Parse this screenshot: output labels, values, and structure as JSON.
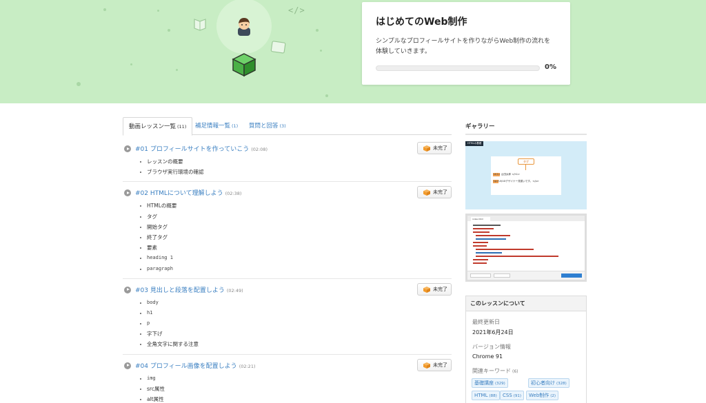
{
  "hero": {
    "code_icon": "</>",
    "title": "はじめてのWeb制作",
    "description": "シンプルなプロフィールサイトを作りながらWeb制作の流れを体験していきます。",
    "progress_percent": 0,
    "progress_label": "0%",
    "colors": {
      "background": "#c8edc4",
      "accent": "#7cc576"
    }
  },
  "tabs": [
    {
      "label": "動画レッスン一覧",
      "count": "(11)",
      "active": true
    },
    {
      "label": "補足情報一覧",
      "count": "(1)",
      "active": false
    },
    {
      "label": "質問と回答",
      "count": "(3)",
      "active": false
    }
  ],
  "lessons": [
    {
      "title": "#01 プロフィールサイトを作っていこう",
      "duration": "(02:08)",
      "status": "未完了",
      "topics": [
        "レッスンの概要",
        "ブラウザ実行環境の確認"
      ]
    },
    {
      "title": "#02 HTMLについて理解しよう",
      "duration": "(02:38)",
      "status": "未完了",
      "topics": [
        "HTMLの概要",
        "タグ",
        "開始タグ",
        "終了タグ",
        "要素",
        "heading 1",
        "paragraph"
      ]
    },
    {
      "title": "#03 見出しと段落を配置しよう",
      "duration": "(02:49)",
      "status": "未完了",
      "topics": [
        "body",
        "h1",
        "p",
        "字下げ",
        "全角文字に関する注意"
      ]
    },
    {
      "title": "#04 プロフィール画像を配置しよう",
      "duration": "(02:21)",
      "status": "未完了",
      "topics": [
        "img",
        "src属性",
        "alt属性"
      ]
    }
  ],
  "sidebar": {
    "gallery_title": "ギャラリー",
    "gallery1": {
      "tag": "HTMLの基礎",
      "box": "タグ",
      "line1": "<h1> 山田太郎 </h1>",
      "line2": "<p>UI/UXデザイナー見習いです。</p>"
    },
    "gallery2": {
      "tab": "index.html"
    },
    "about": {
      "title": "このレッスンについて",
      "updated_label": "最終更新日",
      "updated_value": "2021年6月24日",
      "version_label": "バージョン情報",
      "version_value": "Chrome 91",
      "keywords_label": "関連キーワード",
      "keywords_count": "(6)",
      "keywords": [
        {
          "label": "基礎講座",
          "count": "(329)"
        },
        {
          "label": "初心者向け",
          "count": "(328)"
        },
        {
          "label": "HTML",
          "count": "(88)"
        },
        {
          "label": "CSS",
          "count": "(91)"
        },
        {
          "label": "Web制作",
          "count": "(2)"
        }
      ]
    }
  },
  "icons": {
    "lesson_play": "play-circle-icon",
    "status": "box-icon",
    "hero": [
      "avatar-icon",
      "cube-icon",
      "book-icon",
      "window-icon",
      "code-icon"
    ]
  }
}
